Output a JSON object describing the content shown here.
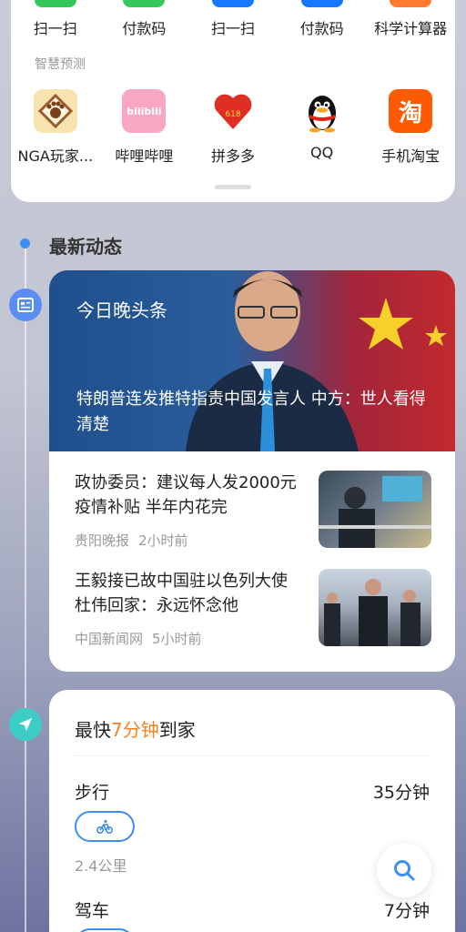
{
  "top_row": [
    {
      "label": "扫一扫",
      "icon": "green-app-icon",
      "color": "#34c759"
    },
    {
      "label": "付款码",
      "icon": "green-app-icon",
      "color": "#34c759"
    },
    {
      "label": "扫一扫",
      "icon": "alipay-icon",
      "color": "#1677ff"
    },
    {
      "label": "付款码",
      "icon": "alipay-icon",
      "color": "#1677ff"
    },
    {
      "label": "科学计算器",
      "icon": "calculator-icon",
      "color": "#ff7a2e"
    }
  ],
  "prediction": {
    "section_label": "智慧预测",
    "apps": [
      {
        "label": "NGA玩家...",
        "icon": "nga-icon"
      },
      {
        "label": "哔哩哔哩",
        "icon": "bilibili-icon",
        "icon_text": "bilibili"
      },
      {
        "label": "拼多多",
        "icon": "pinduoduo-icon",
        "icon_text": "618"
      },
      {
        "label": "QQ",
        "icon": "qq-penguin-icon"
      },
      {
        "label": "手机淘宝",
        "icon": "taobao-icon",
        "icon_text": "淘"
      }
    ]
  },
  "feed": {
    "title": "最新动态",
    "hero": {
      "tag": "今日晚头条",
      "headline": "特朗普连发推特指责中国发言人 中方：世人看得清楚"
    },
    "items": [
      {
        "title": "政协委员：建议每人发2000元疫情补贴 半年内花完",
        "source": "贵阳晚报",
        "time": "2小时前"
      },
      {
        "title": "王毅接已故中国驻以色列大使杜伟回家：永远怀念他",
        "source": "中国新闻网",
        "time": "5小时前"
      }
    ]
  },
  "commute": {
    "prefix": "最快",
    "highlight": "7分钟",
    "suffix": "到家",
    "modes": [
      {
        "name": "步行",
        "duration": "35分钟",
        "distance": "2.4公里",
        "icon": "bike-icon"
      },
      {
        "name": "驾车",
        "duration": "7分钟"
      }
    ]
  },
  "colors": {
    "accent": "#3d8ef0",
    "highlight": "#f58220",
    "nav_icon": "#3ecdc6"
  }
}
